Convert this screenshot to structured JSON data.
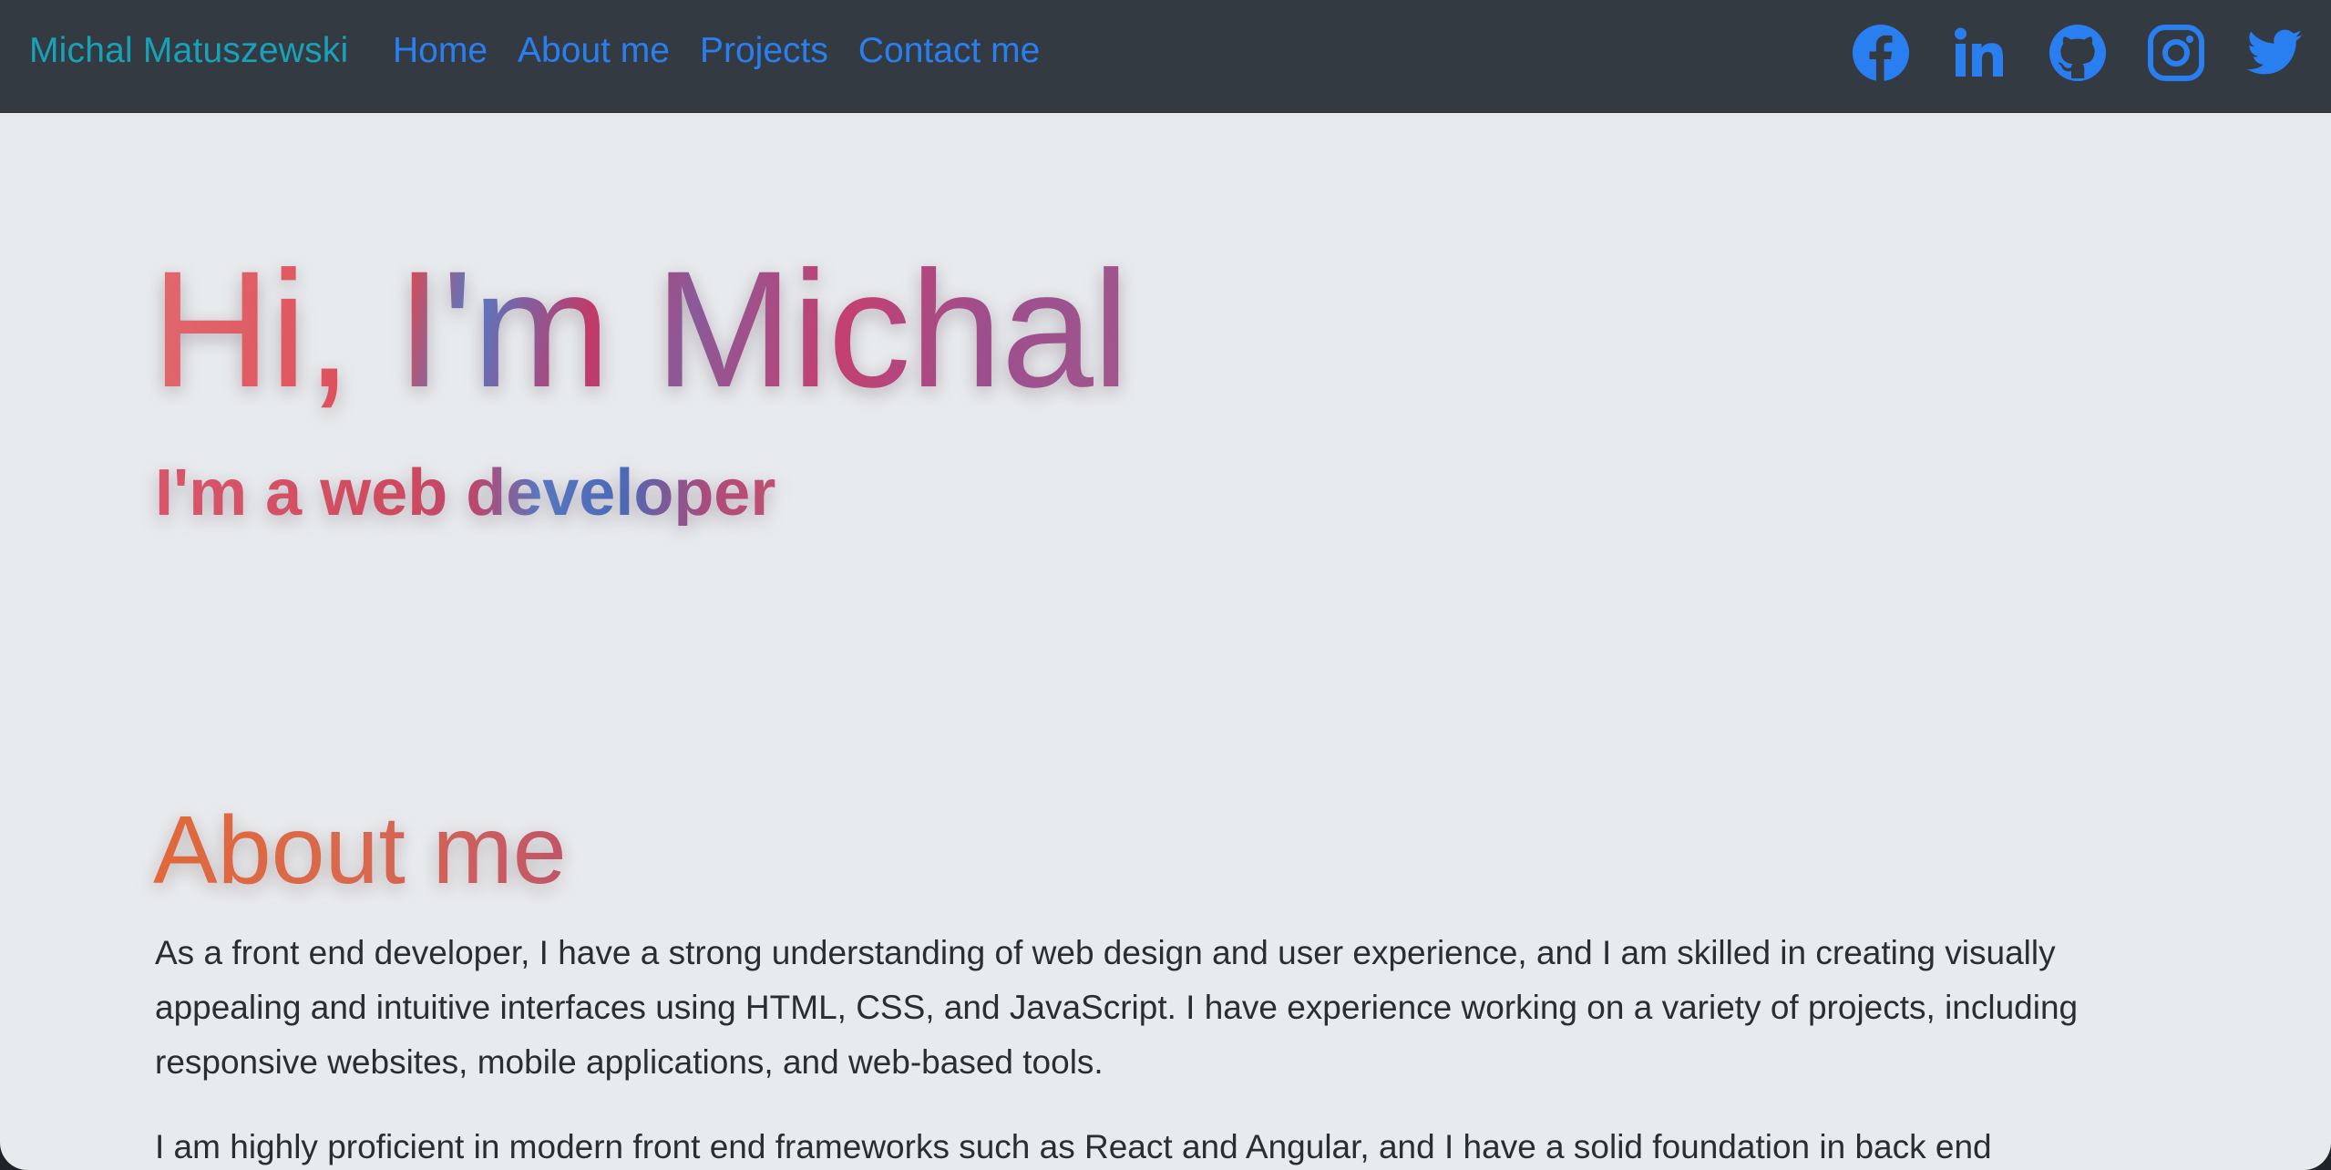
{
  "navbar": {
    "brand": "Michal Matuszewski",
    "links": [
      {
        "label": "Home"
      },
      {
        "label": "About me"
      },
      {
        "label": "Projects"
      },
      {
        "label": "Contact me"
      }
    ],
    "social": [
      {
        "icon": "facebook-icon"
      },
      {
        "icon": "linkedin-icon"
      },
      {
        "icon": "github-icon"
      },
      {
        "icon": "instagram-icon"
      },
      {
        "icon": "twitter-icon"
      }
    ]
  },
  "hero": {
    "title": "Hi, I'm Michal",
    "subtitle": "I'm a web developer"
  },
  "about": {
    "title": "About me",
    "paragraphs": [
      "As a front end developer, I have a strong understanding of web design and user experience, and I am skilled in creating visually appealing and intuitive interfaces using HTML, CSS, and JavaScript. I have experience working on a variety of projects, including responsive websites, mobile applications, and web-based tools.",
      "I am highly proficient in modern front end frameworks such as React and Angular, and I have a solid foundation in back end"
    ]
  },
  "colors": {
    "navbar_bg": "#343a42",
    "brand": "#17a2b8",
    "link": "#2a7ff0",
    "page_bg": "#e8ebee",
    "body_text": "#2a2d31"
  }
}
